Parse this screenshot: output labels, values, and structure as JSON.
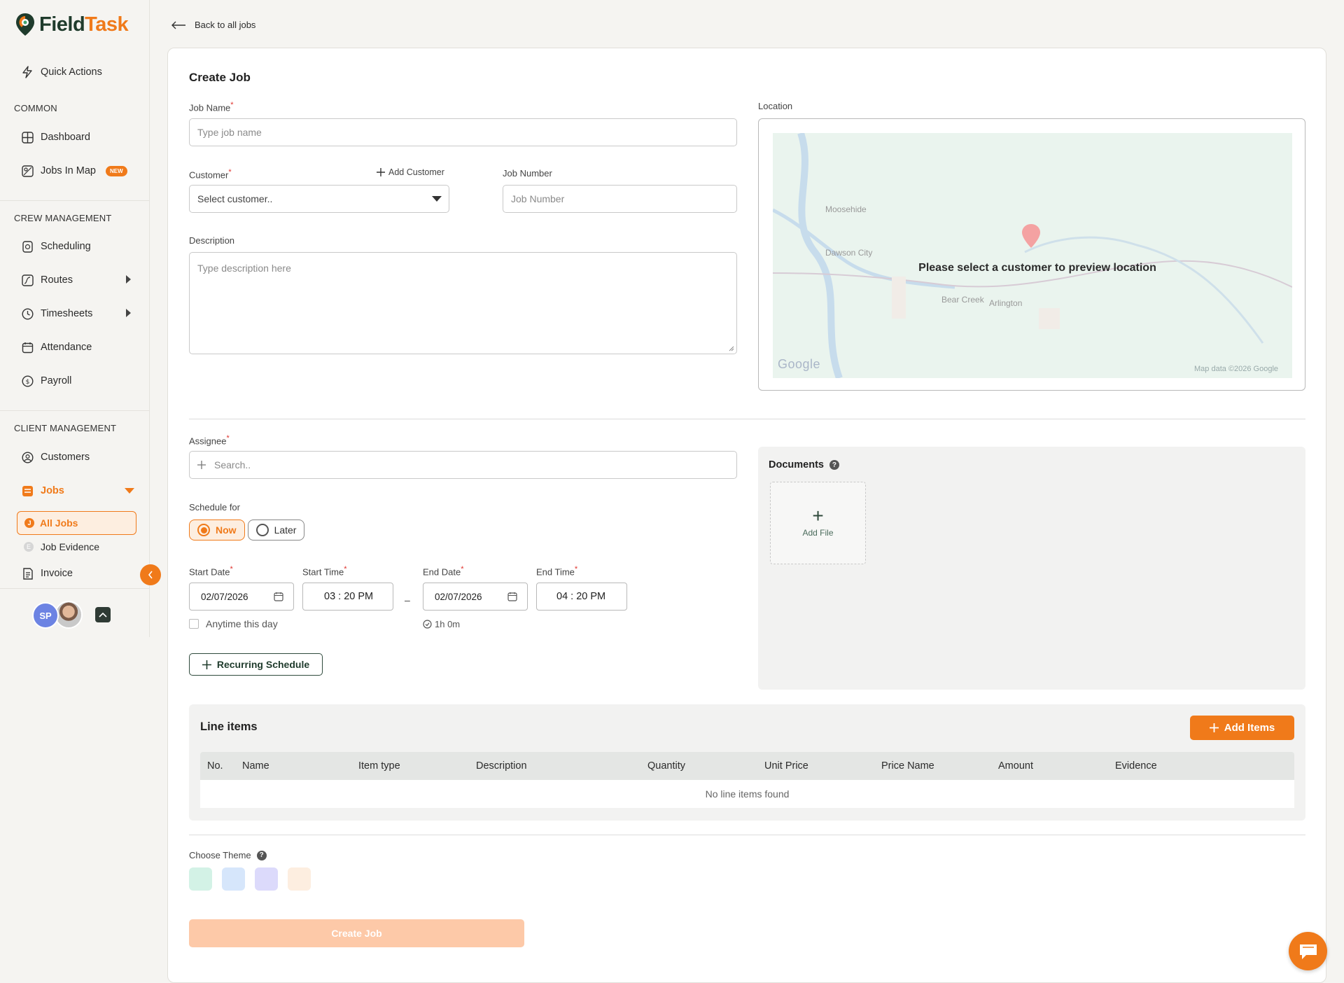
{
  "brand": {
    "name_part1": "Field",
    "name_part2": "Task",
    "accent": "#f07a1a",
    "dark": "#1f3b2c"
  },
  "sidebar": {
    "quick_actions": "Quick Actions",
    "sections": {
      "common": "COMMON",
      "crew": "CREW MANAGEMENT",
      "client": "CLIENT MANAGEMENT"
    },
    "items": {
      "dashboard": "Dashboard",
      "jobs_in_map": "Jobs In Map",
      "new_badge": "NEW",
      "scheduling": "Scheduling",
      "routes": "Routes",
      "timesheets": "Timesheets",
      "attendance": "Attendance",
      "payroll": "Payroll",
      "customers": "Customers",
      "jobs": "Jobs",
      "all_jobs": "All Jobs",
      "job_evidence": "Job Evidence",
      "invoice": "Invoice"
    },
    "user_initials": "SP"
  },
  "back_link": "Back to all jobs",
  "form": {
    "title": "Create Job",
    "job_name_label": "Job Name",
    "job_name_placeholder": "Type job name",
    "customer_label": "Customer",
    "customer_selected": "Select customer..",
    "add_customer": "Add Customer",
    "job_number_label": "Job Number",
    "job_number_placeholder": "Job Number",
    "description_label": "Description",
    "description_placeholder": "Type description here",
    "location_label": "Location",
    "map_message": "Please select a customer to preview location",
    "map_labels": {
      "moosehide": "Moosehide",
      "dawson_city": "Dawson City",
      "bear_creek": "Bear Creek",
      "arlington": "Arlington",
      "google": "Google",
      "map_data": "Map data ©2026 Google"
    },
    "assignee_label": "Assignee",
    "assignee_placeholder": "Search..",
    "schedule_label": "Schedule for",
    "schedule_now": "Now",
    "schedule_later": "Later",
    "start_date_label": "Start Date",
    "start_date": "02/07/2026",
    "start_time_label": "Start Time",
    "start_time": "03 : 20  PM",
    "end_date_label": "End Date",
    "end_date": "02/07/2026",
    "end_time_label": "End Time",
    "end_time": "04 : 20  PM",
    "range_dash": "–",
    "anytime": "Anytime this day",
    "duration": "1h 0m",
    "recurring": "Recurring Schedule",
    "documents_title": "Documents",
    "add_file": "Add File",
    "line_items_title": "Line items",
    "add_items": "Add Items",
    "columns": [
      "No.",
      "Name",
      "Item type",
      "Description",
      "Quantity",
      "Unit Price",
      "Price Name",
      "Amount",
      "Evidence"
    ],
    "empty_line_items": "No line items found",
    "theme_label": "Choose Theme",
    "theme_colors": [
      "#d3f2e6",
      "#d6e6fb",
      "#dcdafb",
      "#fdeee0"
    ],
    "create_button": "Create Job"
  }
}
